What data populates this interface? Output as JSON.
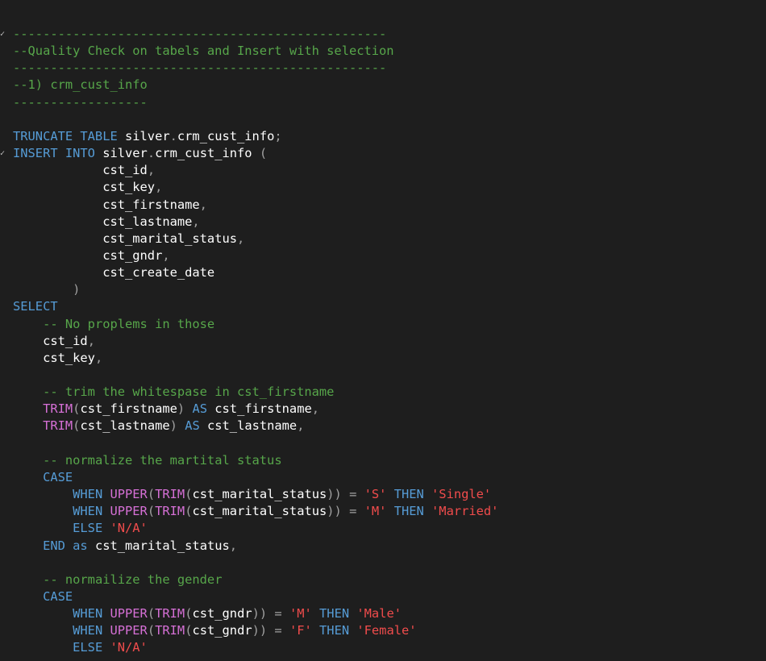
{
  "editor": {
    "language": "sql",
    "colors": {
      "background": "#1e1e1e",
      "keyword": "#569cd6",
      "function": "#d670d6",
      "identifier": "#ffffff",
      "punctuation": "#a0a0a0",
      "string": "#f14c4c",
      "comment": "#57a64a"
    },
    "fold_markers": [
      {
        "line": 1,
        "glyph": "✓"
      },
      {
        "line": 8,
        "glyph": "✓"
      }
    ],
    "lines": [
      [
        {
          "t": "--------------------------------------------------",
          "c": "cm"
        }
      ],
      [
        {
          "t": "--Quality Check on tabels and Insert with selection",
          "c": "cm"
        }
      ],
      [
        {
          "t": "--------------------------------------------------",
          "c": "cm"
        }
      ],
      [
        {
          "t": "--1) crm_cust_info",
          "c": "cm"
        }
      ],
      [
        {
          "t": "------------------",
          "c": "cm"
        }
      ],
      [],
      [
        {
          "t": "TRUNCATE TABLE ",
          "c": "kw"
        },
        {
          "t": "silver",
          "c": "id"
        },
        {
          "t": ".",
          "c": "pu"
        },
        {
          "t": "crm_cust_info",
          "c": "id"
        },
        {
          "t": ";",
          "c": "pu"
        }
      ],
      [
        {
          "t": "INSERT INTO ",
          "c": "kw"
        },
        {
          "t": "silver",
          "c": "id"
        },
        {
          "t": ".",
          "c": "pu"
        },
        {
          "t": "crm_cust_info",
          "c": "id"
        },
        {
          "t": " (",
          "c": "pu"
        }
      ],
      [
        {
          "t": "            ",
          "c": "tx"
        },
        {
          "t": "cst_id",
          "c": "id"
        },
        {
          "t": ",",
          "c": "pu"
        }
      ],
      [
        {
          "t": "            ",
          "c": "tx"
        },
        {
          "t": "cst_key",
          "c": "id"
        },
        {
          "t": ",",
          "c": "pu"
        }
      ],
      [
        {
          "t": "            ",
          "c": "tx"
        },
        {
          "t": "cst_firstname",
          "c": "id"
        },
        {
          "t": ",",
          "c": "pu"
        }
      ],
      [
        {
          "t": "            ",
          "c": "tx"
        },
        {
          "t": "cst_lastname",
          "c": "id"
        },
        {
          "t": ",",
          "c": "pu"
        }
      ],
      [
        {
          "t": "            ",
          "c": "tx"
        },
        {
          "t": "cst_marital_status",
          "c": "id"
        },
        {
          "t": ",",
          "c": "pu"
        }
      ],
      [
        {
          "t": "            ",
          "c": "tx"
        },
        {
          "t": "cst_gndr",
          "c": "id"
        },
        {
          "t": ",",
          "c": "pu"
        }
      ],
      [
        {
          "t": "            ",
          "c": "tx"
        },
        {
          "t": "cst_create_date",
          "c": "id"
        }
      ],
      [
        {
          "t": "        ",
          "c": "tx"
        },
        {
          "t": ")",
          "c": "pu"
        }
      ],
      [
        {
          "t": "SELECT",
          "c": "kw"
        }
      ],
      [
        {
          "t": "    ",
          "c": "tx"
        },
        {
          "t": "-- No proplems in those",
          "c": "cm"
        }
      ],
      [
        {
          "t": "    ",
          "c": "tx"
        },
        {
          "t": "cst_id",
          "c": "id"
        },
        {
          "t": ",",
          "c": "pu"
        }
      ],
      [
        {
          "t": "    ",
          "c": "tx"
        },
        {
          "t": "cst_key",
          "c": "id"
        },
        {
          "t": ",",
          "c": "pu"
        }
      ],
      [],
      [
        {
          "t": "    ",
          "c": "tx"
        },
        {
          "t": "-- trim the whitespase in cst_firstname",
          "c": "cm"
        }
      ],
      [
        {
          "t": "    ",
          "c": "tx"
        },
        {
          "t": "TRIM",
          "c": "fn"
        },
        {
          "t": "(",
          "c": "pu"
        },
        {
          "t": "cst_firstname",
          "c": "id"
        },
        {
          "t": ") ",
          "c": "pu"
        },
        {
          "t": "AS ",
          "c": "kw"
        },
        {
          "t": "cst_firstname",
          "c": "id"
        },
        {
          "t": ",",
          "c": "pu"
        }
      ],
      [
        {
          "t": "    ",
          "c": "tx"
        },
        {
          "t": "TRIM",
          "c": "fn"
        },
        {
          "t": "(",
          "c": "pu"
        },
        {
          "t": "cst_lastname",
          "c": "id"
        },
        {
          "t": ") ",
          "c": "pu"
        },
        {
          "t": "AS ",
          "c": "kw"
        },
        {
          "t": "cst_lastname",
          "c": "id"
        },
        {
          "t": ",",
          "c": "pu"
        }
      ],
      [],
      [
        {
          "t": "    ",
          "c": "tx"
        },
        {
          "t": "-- normalize the martital status",
          "c": "cm"
        }
      ],
      [
        {
          "t": "    ",
          "c": "tx"
        },
        {
          "t": "CASE",
          "c": "kw"
        }
      ],
      [
        {
          "t": "        ",
          "c": "tx"
        },
        {
          "t": "WHEN ",
          "c": "kw"
        },
        {
          "t": "UPPER",
          "c": "fn"
        },
        {
          "t": "(",
          "c": "pu"
        },
        {
          "t": "TRIM",
          "c": "fn"
        },
        {
          "t": "(",
          "c": "pu"
        },
        {
          "t": "cst_marital_status",
          "c": "id"
        },
        {
          "t": ")) = ",
          "c": "pu"
        },
        {
          "t": "'S'",
          "c": "str"
        },
        {
          "t": " THEN ",
          "c": "kw"
        },
        {
          "t": "'Single'",
          "c": "str"
        }
      ],
      [
        {
          "t": "        ",
          "c": "tx"
        },
        {
          "t": "WHEN ",
          "c": "kw"
        },
        {
          "t": "UPPER",
          "c": "fn"
        },
        {
          "t": "(",
          "c": "pu"
        },
        {
          "t": "TRIM",
          "c": "fn"
        },
        {
          "t": "(",
          "c": "pu"
        },
        {
          "t": "cst_marital_status",
          "c": "id"
        },
        {
          "t": ")) = ",
          "c": "pu"
        },
        {
          "t": "'M'",
          "c": "str"
        },
        {
          "t": " THEN ",
          "c": "kw"
        },
        {
          "t": "'Married'",
          "c": "str"
        }
      ],
      [
        {
          "t": "        ",
          "c": "tx"
        },
        {
          "t": "ELSE ",
          "c": "kw"
        },
        {
          "t": "'N/A'",
          "c": "str"
        }
      ],
      [
        {
          "t": "    ",
          "c": "tx"
        },
        {
          "t": "END ",
          "c": "kw"
        },
        {
          "t": "as ",
          "c": "kw"
        },
        {
          "t": "cst_marital_status",
          "c": "id"
        },
        {
          "t": ",",
          "c": "pu"
        }
      ],
      [],
      [
        {
          "t": "    ",
          "c": "tx"
        },
        {
          "t": "-- normailize the gender",
          "c": "cm"
        }
      ],
      [
        {
          "t": "    ",
          "c": "tx"
        },
        {
          "t": "CASE",
          "c": "kw"
        }
      ],
      [
        {
          "t": "        ",
          "c": "tx"
        },
        {
          "t": "WHEN ",
          "c": "kw"
        },
        {
          "t": "UPPER",
          "c": "fn"
        },
        {
          "t": "(",
          "c": "pu"
        },
        {
          "t": "TRIM",
          "c": "fn"
        },
        {
          "t": "(",
          "c": "pu"
        },
        {
          "t": "cst_gndr",
          "c": "id"
        },
        {
          "t": ")) = ",
          "c": "pu"
        },
        {
          "t": "'M'",
          "c": "str"
        },
        {
          "t": " THEN ",
          "c": "kw"
        },
        {
          "t": "'Male'",
          "c": "str"
        }
      ],
      [
        {
          "t": "        ",
          "c": "tx"
        },
        {
          "t": "WHEN ",
          "c": "kw"
        },
        {
          "t": "UPPER",
          "c": "fn"
        },
        {
          "t": "(",
          "c": "pu"
        },
        {
          "t": "TRIM",
          "c": "fn"
        },
        {
          "t": "(",
          "c": "pu"
        },
        {
          "t": "cst_gndr",
          "c": "id"
        },
        {
          "t": ")) = ",
          "c": "pu"
        },
        {
          "t": "'F'",
          "c": "str"
        },
        {
          "t": " THEN ",
          "c": "kw"
        },
        {
          "t": "'Female'",
          "c": "str"
        }
      ],
      [
        {
          "t": "        ",
          "c": "tx"
        },
        {
          "t": "ELSE ",
          "c": "kw"
        },
        {
          "t": "'N/A'",
          "c": "str"
        }
      ]
    ]
  }
}
